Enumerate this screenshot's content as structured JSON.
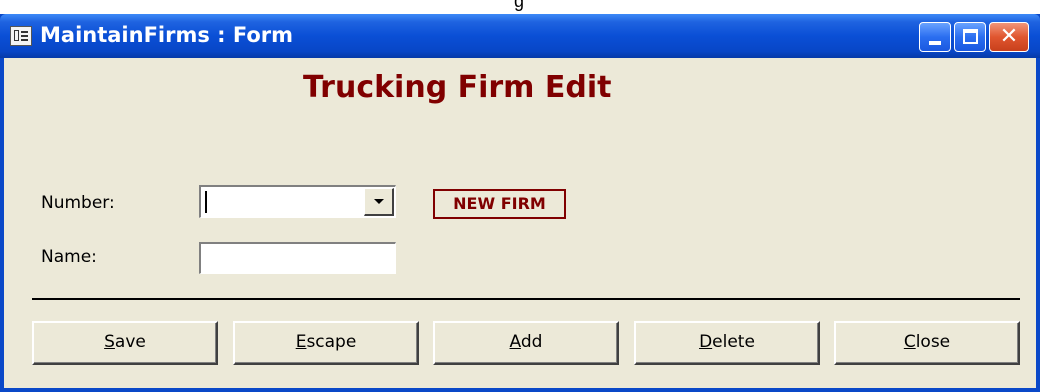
{
  "top_sliver_text": "g",
  "window": {
    "title": "MaintainFirms : Form"
  },
  "form": {
    "heading": "Trucking Firm Edit",
    "number_label": "Number:",
    "number_value": "",
    "name_label": "Name:",
    "name_value": "",
    "new_firm_label": "NEW FIRM"
  },
  "buttons": [
    {
      "accel": "S",
      "rest": "ave"
    },
    {
      "accel": "E",
      "rest": "scape"
    },
    {
      "accel": "A",
      "rest": "dd"
    },
    {
      "accel": "D",
      "rest": "elete"
    },
    {
      "accel": "C",
      "rest": "lose"
    }
  ],
  "colors": {
    "titlebar_blue": "#0a4fd6",
    "form_background": "#ece9d8",
    "heading_maroon": "#800000",
    "close_button_red": "#e0562f"
  },
  "icons": [
    "form-icon",
    "minimize-icon",
    "maximize-icon",
    "close-icon",
    "dropdown-arrow-icon"
  ]
}
